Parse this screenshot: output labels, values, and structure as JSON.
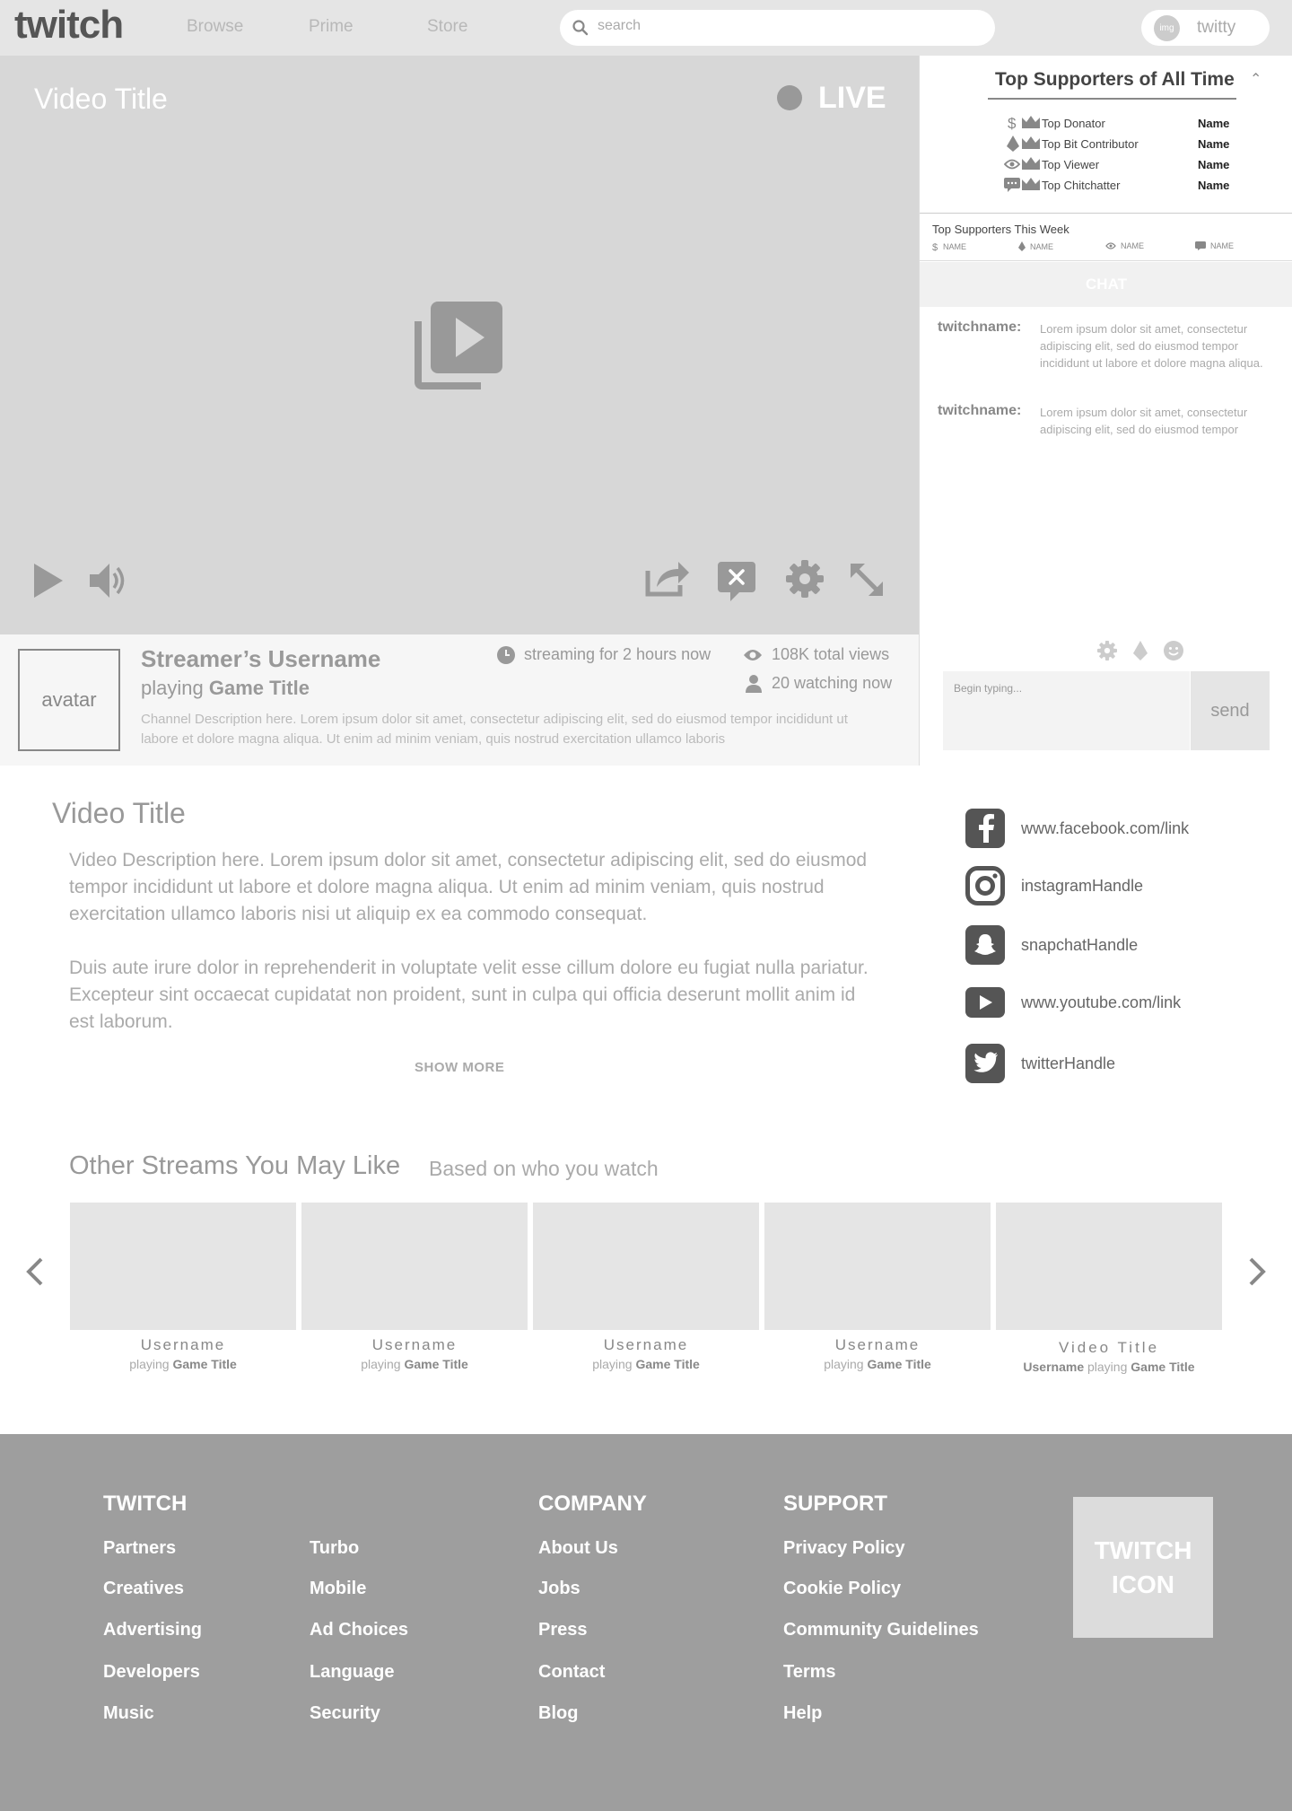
{
  "nav": {
    "logo": "twitch",
    "links": [
      "Browse",
      "Prime",
      "Store"
    ],
    "search_placeholder": "search",
    "avatar_text": "img",
    "username": "twitty"
  },
  "player": {
    "title": "Video Title",
    "live_label": "LIVE"
  },
  "streamer": {
    "avatar_label": "avatar",
    "username": "Streamer’s Username",
    "playing_prefix": "playing ",
    "game": "Game Title",
    "streaming_for": "streaming for 2 hours now",
    "total_views": "108K total views",
    "watching": "20 watching now",
    "description": "Channel Description here. Lorem ipsum dolor sit amet, consectetur adipiscing elit, sed do eiusmod tempor incididunt ut labore et dolore magna aliqua. Ut enim ad minim veniam, quis nostrud exercitation ullamco laboris"
  },
  "supporters": {
    "title": "Top Supporters of All Time",
    "rows": [
      {
        "label": "Top Donator",
        "value": "Name",
        "icon": "dollar-icon"
      },
      {
        "label": "Top Bit Contributor",
        "value": "Name",
        "icon": "bit-icon"
      },
      {
        "label": "Top Viewer",
        "value": "Name",
        "icon": "eye-icon"
      },
      {
        "label": "Top Chitchatter",
        "value": "Name",
        "icon": "chat-bubble-icon"
      }
    ],
    "week_title": "Top Supporters This Week",
    "week_items": [
      "NAME",
      "NAME",
      "NAME",
      "NAME"
    ]
  },
  "chat": {
    "header": "CHAT",
    "messages": [
      {
        "user": "twitchname:",
        "text": "Lorem ipsum dolor sit amet, consectetur adipiscing elit, sed do eiusmod tempor incididunt ut labore et dolore magna aliqua."
      },
      {
        "user": "twitchname:",
        "text": "Lorem ipsum dolor sit amet, consectetur adipiscing elit, sed do eiusmod tempor"
      }
    ],
    "input_placeholder": "Begin typing...",
    "send_label": "send"
  },
  "description": {
    "title": "Video Title",
    "paragraphs": [
      "Video Description here. Lorem ipsum dolor sit amet, consectetur adipiscing elit, sed do eiusmod tempor incididunt ut labore et dolore magna aliqua. Ut enim ad minim veniam, quis nostrud exercitation ullamco laboris nisi ut aliquip ex ea commodo consequat.",
      "Duis aute irure dolor in reprehenderit in voluptate velit esse cillum dolore eu fugiat nulla pariatur. Excepteur sint occaecat cupidatat non proident, sunt in culpa qui officia deserunt mollit anim id est laborum."
    ],
    "show_more": "SHOW MORE"
  },
  "socials": [
    {
      "icon": "facebook-icon",
      "text": "www.facebook.com/link"
    },
    {
      "icon": "instagram-icon",
      "text": "instagramHandle"
    },
    {
      "icon": "snapchat-icon",
      "text": "snapchatHandle"
    },
    {
      "icon": "youtube-icon",
      "text": "www.youtube.com/link"
    },
    {
      "icon": "twitter-icon",
      "text": "twitterHandle"
    }
  ],
  "other_streams": {
    "title": "Other Streams You May Like",
    "subtitle": "Based on who you watch",
    "playing": "playing",
    "items": [
      {
        "username": "Username",
        "game": "Game Title"
      },
      {
        "username": "Username",
        "game": "Game Title"
      },
      {
        "username": "Username",
        "game": "Game Title"
      },
      {
        "username": "Username",
        "game": "Game Title"
      },
      {
        "video_title": "Video Title",
        "username": "Username",
        "game": "Game Title"
      }
    ]
  },
  "footer": {
    "twitch": {
      "heading": "TWITCH",
      "col1": [
        "Partners",
        "Creatives",
        "Advertising",
        "Developers",
        "Music"
      ],
      "col2": [
        "Turbo",
        "Mobile",
        "Ad Choices",
        "Language",
        "Security"
      ]
    },
    "company": {
      "heading": "COMPANY",
      "links": [
        "About Us",
        "Jobs",
        "Press",
        "Contact",
        "Blog"
      ]
    },
    "support": {
      "heading": "SUPPORT",
      "links": [
        "Privacy Policy",
        "Cookie Policy",
        "Community Guidelines",
        "Terms",
        "Help"
      ]
    },
    "icon_line1": "TWITCH",
    "icon_line2": "ICON"
  }
}
